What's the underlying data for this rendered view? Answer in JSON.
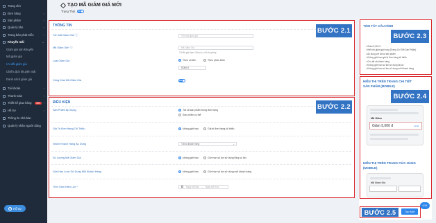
{
  "sidebar": {
    "items": [
      {
        "label": "Trang chủ",
        "chev": "",
        "type": "main"
      },
      {
        "label": "Đơn hàng",
        "chev": "›",
        "type": "main"
      },
      {
        "label": "Sản phẩm",
        "chev": "›",
        "type": "main"
      },
      {
        "label": "Quản lý kho",
        "chev": "›",
        "type": "main"
      },
      {
        "label": "Trang bán phát triển",
        "chev": "›",
        "type": "main"
      },
      {
        "label": "Khuyến mãi",
        "chev": "⌄",
        "type": "bold"
      },
      {
        "label": "Giảm giá sản khuyến",
        "chev": "",
        "type": "sub"
      },
      {
        "label": "Mã giảm giá",
        "chev": "",
        "type": "sub"
      },
      {
        "label": "Ưu đãi giảm giá",
        "chev": "",
        "type": "active"
      },
      {
        "label": "Chiến dịch khuyến mãi",
        "chev": "",
        "type": "sub"
      },
      {
        "label": "Danh sách giảm giá",
        "chev": "",
        "type": "sub"
      },
      {
        "label": "Tài khoản",
        "chev": "›",
        "type": "main"
      },
      {
        "label": "Thanh toán",
        "chev": "›",
        "type": "main"
      },
      {
        "label": "Thiết kế giao hàng",
        "chev": "›",
        "type": "main",
        "badge": "Mới"
      },
      {
        "label": "Hỗ trợ",
        "chev": "›",
        "type": "main"
      },
      {
        "label": "Thông tin nhà bán",
        "chev": "",
        "type": "main"
      },
      {
        "label": "Quản lý nhân người dùng",
        "chev": "",
        "type": "main"
      }
    ],
    "help_label": "Hỗ trợ",
    "help_icon": "question-icon"
  },
  "header": {
    "title": "TẠO MÃ GIẢM GIÁ MỚI",
    "status_label": "Trạng Thái",
    "status_toggle": "Bật"
  },
  "thong_tin": {
    "title": "THÔNG TIN",
    "name_label": "Tên Mã Giảm Giá* ⓘ",
    "name_placeholder": "Tên mã giảm giá",
    "code_label": "Mã Giảm Giá* ⓘ",
    "code_placeholder": "Mã Giảm Giá",
    "code_hint": "Tối đa giới hạn 15 ký tự, chỉ cho phép",
    "type_label": "Loại Giảm Giá",
    "type_options": [
      "Theo số tiền",
      "Theo phần trăm"
    ],
    "type_value": "5,000 đ",
    "public_label": "Công Khai Mã Giảm Giá",
    "public_toggle": "Bật"
  },
  "dieu_kien": {
    "title": "ĐIỀU KIỆN",
    "rows": [
      {
        "label": "Sản Phẩm Áp Dụng",
        "options": [
          "Tất cả sản phẩm trong đơn hàng",
          "Sản phẩm cụ thể"
        ],
        "layout": "stack"
      },
      {
        "label": "Giá Trị Đơn Hàng Tối Thiểu",
        "options": [
          "không giới hạn",
          "Giá trị đơn hàng tối thiểu"
        ],
        "layout": "inline"
      },
      {
        "label": "Nhóm Khách Hàng Áp Dụng",
        "select": "Tất cả khách hàng",
        "layout": "select"
      },
      {
        "label": "Số Lượng Mã Giảm Giá",
        "options": [
          "không giới hạn",
          "Giới hạn số lần sử dụng tổng số lần"
        ],
        "layout": "inline"
      },
      {
        "label": "Giới Hạn Lượt Sử Dụng Mỗi Khách Hàng",
        "options": [
          "không giới hạn",
          "Giới hạn số lần sử dụng mỗi khách hàng"
        ],
        "layout": "inline"
      },
      {
        "label": "Thời Gian Hiệu Lực *",
        "dates": [
          "Ngày bắt đầu",
          "Ngày kết thúc"
        ],
        "layout": "dates"
      }
    ]
  },
  "right_panel": {
    "summary_title": "TÓM TẮT CẤU HÌNH",
    "summary_lines": [
      "• Giảm 5,000 đ",
      "• Hiển thị giảm giá trong [Trang Chi Tiết Sản Phẩm]",
      "• Áp dụng với tất cả sản phẩm",
      "• Không giới hạn giá trị đơn hàng tối thiểu",
      "• Cho tất cả khách hàng",
      "• Không giới hạn số lần sử dụng tất cả",
      "• Không giới hạn số lần sử dụng mỗi khách hàng"
    ],
    "pdp_title": "HIỂN THỊ TRÊN TRANG CHI TIẾT SẢN PHẨM (MOBILE)",
    "voucher_label": "Mã Giảm",
    "voucher_value": "Giảm 5,000 đ",
    "voucher_action": "Lưu",
    "shop_title": "HIỂN THỊ TRÊN TRANG CỬA HÀNG (MOBILE)",
    "shop_voucher_label": "Mã Giảm Giá",
    "save_label": "Tạo Mới",
    "float_label": "0/24"
  },
  "steps": {
    "s21": "BƯỚC 2.1",
    "s22": "BƯỚC 2.2",
    "s23": "BƯỚC 2.3",
    "s24": "BƯỚC 2.4",
    "s25": "BƯỚC 2.5"
  },
  "colors": {
    "sidebar_bg": "#1f2a3a",
    "accent": "#2f86eb",
    "highlight_border": "#d9262b",
    "step_badge": "#3373c4"
  }
}
